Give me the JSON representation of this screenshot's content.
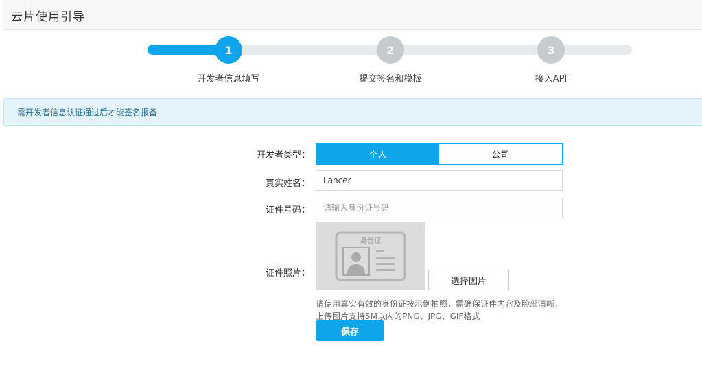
{
  "header": {
    "title": "云片使用引导"
  },
  "stepper": {
    "progress_fraction": 0.17,
    "steps": [
      {
        "number": "1",
        "label": "开发者信息填写",
        "state": "active"
      },
      {
        "number": "2",
        "label": "提交签名和模板",
        "state": "inactive"
      },
      {
        "number": "3",
        "label": "接入API",
        "state": "inactive"
      }
    ]
  },
  "notice": {
    "text": "需开发者信息认证通过后才能签名报备"
  },
  "form": {
    "developer_type_label": "开发者类型：",
    "developer_type_options": [
      "个人",
      "公司"
    ],
    "developer_type_selected": "个人",
    "name_label": "真实姓名：",
    "name_value": "Lancer",
    "id_label": "证件号码：",
    "id_placeholder": "请输入身份证号码",
    "photo_label": "证件照片：",
    "photo_card_text": "身份证",
    "choose_button": "选择图片",
    "hint_line1": "请使用真实有效的身份证按示例拍照，需确保证件内容及脸部清晰，",
    "hint_line2": "上传图片支持5M以内的PNG、JPG、GIF格式",
    "save_button": "保存"
  },
  "colors": {
    "accent": "#0ea5ea",
    "inactive_step": "#c6cbd0"
  }
}
